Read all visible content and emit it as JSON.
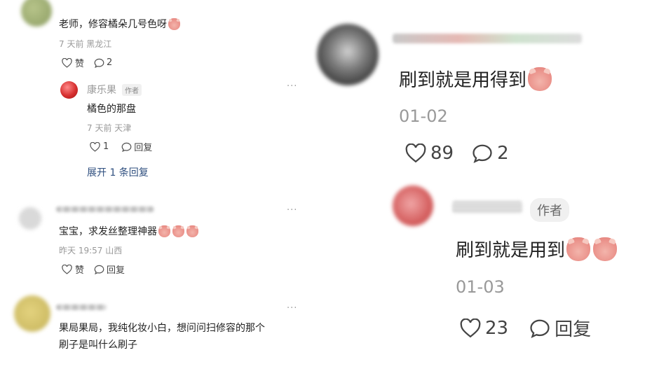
{
  "left": {
    "comment1": {
      "text": "老师，修容橘朵几号色呀",
      "meta": "7 天前 黑龙江",
      "like_label": "赞",
      "reply_count": "2",
      "reply": {
        "author": "康乐果",
        "author_badge": "作者",
        "text": "橘色的那盘",
        "meta": "7 天前 天津",
        "like_count": "1",
        "reply_label": "回复",
        "expand": "展开 1 条回复",
        "more": "···"
      }
    },
    "comment2": {
      "text": "宝宝，求发丝整理神器",
      "meta": "昨天 19:57 山西",
      "like_label": "赞",
      "reply_label": "回复",
      "more": "···"
    },
    "comment3": {
      "text_line1": "果局果局，我纯化妆小白，想问问扫修容的那个",
      "text_line2": "刷子是叫什么刷子",
      "more": "···"
    }
  },
  "right": {
    "comment1": {
      "text": "刷到就是用得到",
      "date": "01-02",
      "like_count": "89",
      "reply_count": "2"
    },
    "comment2": {
      "author_badge": "作者",
      "text": "刷到就是用到",
      "date": "01-03",
      "like_count": "23",
      "reply_label": "回复"
    }
  },
  "icons": {
    "like": "heart-outline-icon",
    "comment": "speech-bubble-icon",
    "more": "more-dots-icon",
    "emoji": "pink-pig-face-emoji"
  },
  "colors": {
    "text": "#222222",
    "meta": "#999999",
    "link": "#2f4f7f",
    "badge_bg": "#f0f0f0"
  }
}
